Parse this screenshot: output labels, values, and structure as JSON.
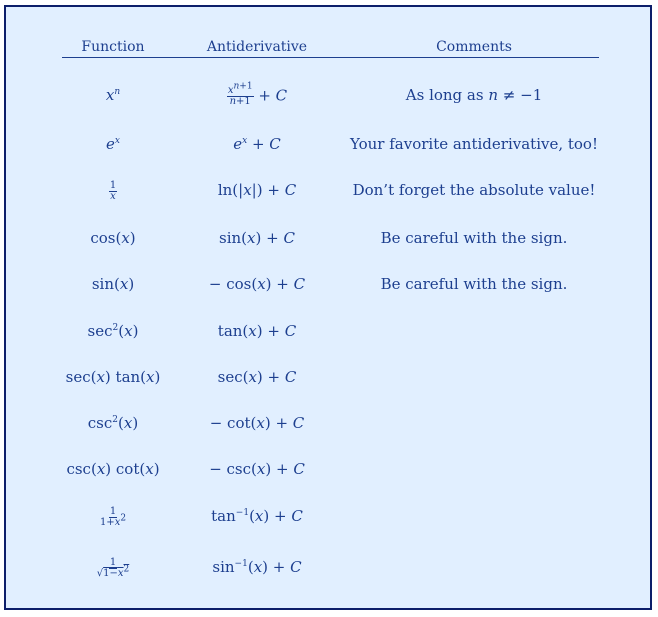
{
  "headers": {
    "function": "Function",
    "antiderivative": "Antiderivative",
    "comments": "Comments"
  },
  "rows": [
    {
      "function": "x^n",
      "antiderivative": "x^(n+1)/(n+1) + C",
      "comment": "As long as n ≠ −1"
    },
    {
      "function": "e^x",
      "antiderivative": "e^x + C",
      "comment": "Your favorite antiderivative, too!"
    },
    {
      "function": "1/x",
      "antiderivative": "ln(|x|) + C",
      "comment": "Don’t forget the absolute value!"
    },
    {
      "function": "cos(x)",
      "antiderivative": "sin(x) + C",
      "comment": "Be careful with the sign."
    },
    {
      "function": "sin(x)",
      "antiderivative": "− cos(x) + C",
      "comment": "Be careful with the sign."
    },
    {
      "function": "sec^2(x)",
      "antiderivative": "tan(x) + C",
      "comment": ""
    },
    {
      "function": "sec(x) tan(x)",
      "antiderivative": "sec(x) + C",
      "comment": ""
    },
    {
      "function": "csc^2(x)",
      "antiderivative": "− cot(x) + C",
      "comment": ""
    },
    {
      "function": "csc(x) cot(x)",
      "antiderivative": "− csc(x) + C",
      "comment": ""
    },
    {
      "function": "1/(1+x^2)",
      "antiderivative": "tan^(−1)(x) + C",
      "comment": ""
    },
    {
      "function": "1/√(1−x^2)",
      "antiderivative": "sin^(−1)(x) + C",
      "comment": ""
    }
  ]
}
